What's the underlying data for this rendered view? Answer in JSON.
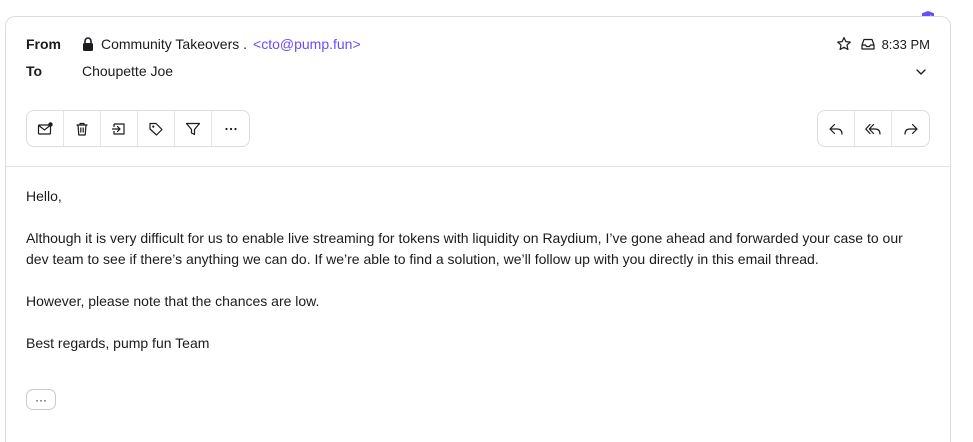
{
  "header": {
    "from_label": "From",
    "to_label": "To",
    "sender_name": "Community Takeovers .",
    "sender_email": "<cto@pump.fun>",
    "recipient": "Choupette Joe",
    "time": "8:33 PM"
  },
  "icons": {
    "verified": "shield-check-icon",
    "lock": "lock-icon",
    "star": "star-icon",
    "inbox": "inbox-icon",
    "expand": "chevron-down-icon"
  },
  "toolbar_left": [
    "mark-unread-icon",
    "trash-icon",
    "move-to-folder-icon",
    "label-icon",
    "filter-icon",
    "more-icon"
  ],
  "toolbar_right": [
    "reply-icon",
    "reply-all-icon",
    "forward-icon"
  ],
  "colors": {
    "accent": "#6d4aff",
    "border": "#dcdce3",
    "text": "#1b1b1f"
  },
  "body": {
    "greeting": "Hello,",
    "paragraph1": "Although it is very difficult for us to enable live streaming for tokens with liquidity on Raydium, I’ve gone ahead and forwarded your case to our dev team to see if there’s anything we can do. If we’re able to find a solution, we’ll follow up with you directly in this email thread.",
    "paragraph2": "However, please note that the chances are low.",
    "signoff": "Best regards, pump fun Team"
  },
  "more_button": "···"
}
